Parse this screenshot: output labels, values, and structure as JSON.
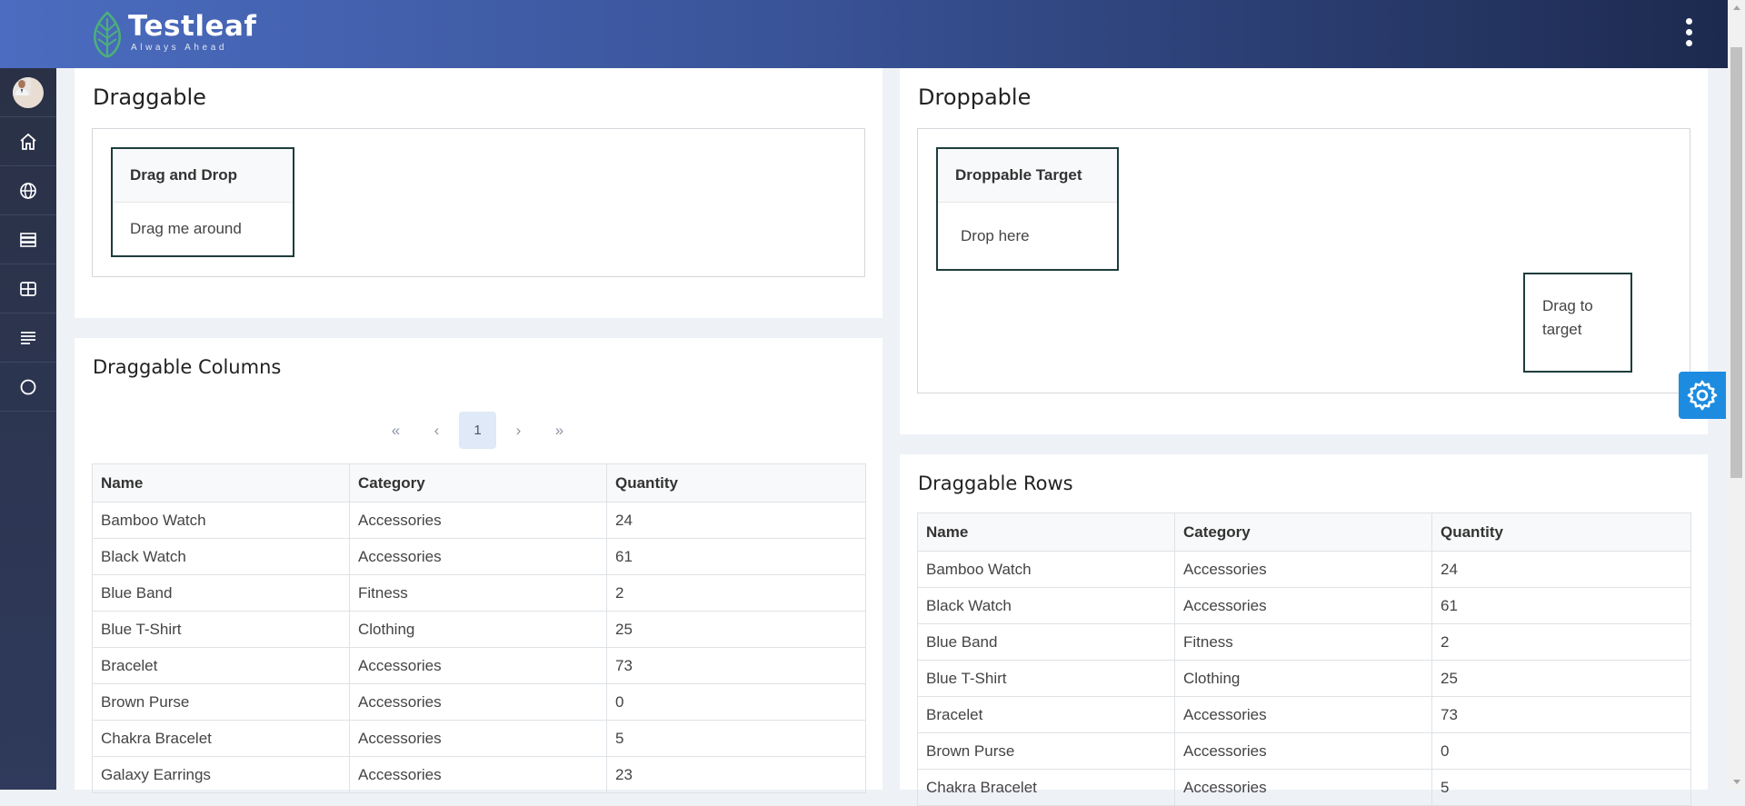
{
  "header": {
    "logo_title": "Testleaf",
    "logo_tagline": "Always Ahead"
  },
  "sidebar": {
    "items": [
      {
        "icon": "avatar"
      },
      {
        "icon": "home-icon"
      },
      {
        "icon": "globe-icon"
      },
      {
        "icon": "server-icon"
      },
      {
        "icon": "grid-icon"
      },
      {
        "icon": "align-left-icon"
      },
      {
        "icon": "circle-icon"
      }
    ]
  },
  "draggable": {
    "title": "Draggable",
    "panel_header": "Drag and Drop",
    "panel_body": "Drag me around"
  },
  "droppable": {
    "title": "Droppable",
    "target_header": "Droppable Target",
    "target_body": "Drop here",
    "source_text": "Drag to target"
  },
  "draggable_columns": {
    "title": "Draggable Columns",
    "paginator": {
      "first": "«",
      "prev": "‹",
      "page": "1",
      "next": "›",
      "last": "»"
    },
    "headers": [
      "Name",
      "Category",
      "Quantity"
    ],
    "rows": [
      [
        "Bamboo Watch",
        "Accessories",
        "24"
      ],
      [
        "Black Watch",
        "Accessories",
        "61"
      ],
      [
        "Blue Band",
        "Fitness",
        "2"
      ],
      [
        "Blue T-Shirt",
        "Clothing",
        "25"
      ],
      [
        "Bracelet",
        "Accessories",
        "73"
      ],
      [
        "Brown Purse",
        "Accessories",
        "0"
      ],
      [
        "Chakra Bracelet",
        "Accessories",
        "5"
      ],
      [
        "Galaxy Earrings",
        "Accessories",
        "23"
      ]
    ]
  },
  "draggable_rows": {
    "title": "Draggable Rows",
    "headers": [
      "Name",
      "Category",
      "Quantity"
    ],
    "rows": [
      [
        "Bamboo Watch",
        "Accessories",
        "24"
      ],
      [
        "Black Watch",
        "Accessories",
        "61"
      ],
      [
        "Blue Band",
        "Fitness",
        "2"
      ],
      [
        "Blue T-Shirt",
        "Clothing",
        "25"
      ],
      [
        "Bracelet",
        "Accessories",
        "73"
      ],
      [
        "Brown Purse",
        "Accessories",
        "0"
      ],
      [
        "Chakra Bracelet",
        "Accessories",
        "5"
      ]
    ]
  },
  "colors": {
    "header_start": "#4b6cc0",
    "header_end": "#1d2a4f",
    "sidebar": "#2a3146",
    "logo_green": "#4caf7a",
    "config_button": "#1d8ce0"
  }
}
